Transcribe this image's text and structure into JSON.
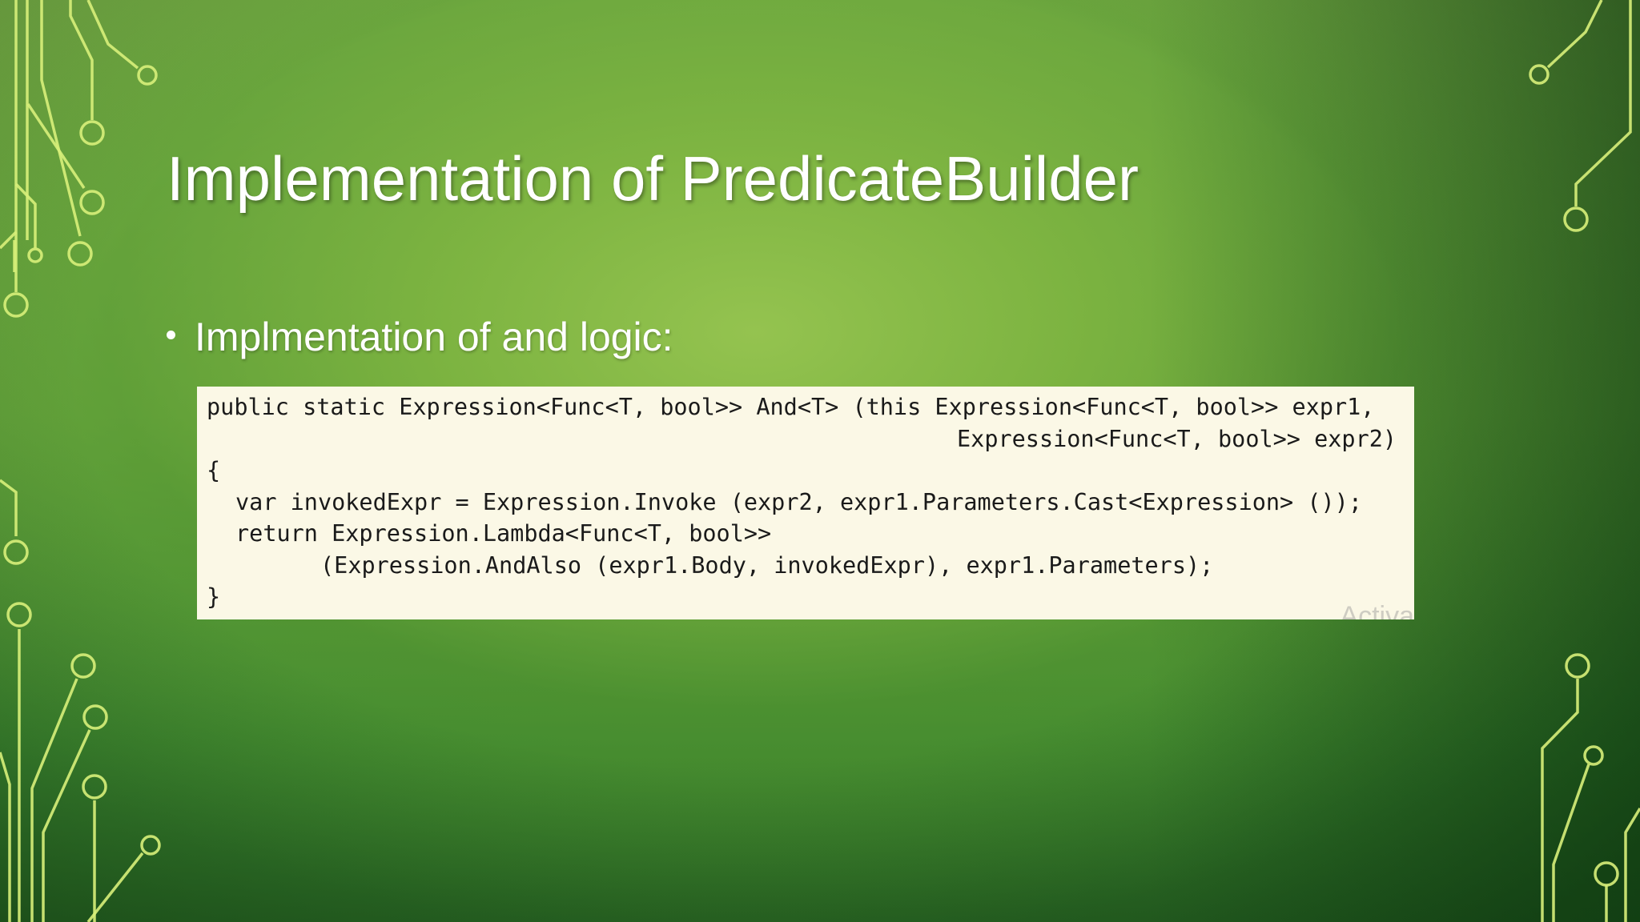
{
  "slide": {
    "title": "Implementation of PredicateBuilder",
    "bullet": "Implmentation of and logic:",
    "code": {
      "line1": "public static Expression<Func<T, bool>> And<T> (this Expression<Func<T, bool>> expr1,",
      "line2": "Expression<Func<T, bool>> expr2)",
      "line3": "{",
      "line4": "var invokedExpr = Expression.Invoke (expr2, expr1.Parameters.Cast<Expression> ());",
      "line5": "return Expression.Lambda<Func<T, bool>>",
      "line6": "(Expression.AndAlso (expr1.Body, invokedExpr), expr1.Parameters);",
      "line7": "}"
    },
    "watermark": "Activa"
  },
  "colors": {
    "background_center": "#8cc152",
    "background_edge": "#2b6a25",
    "circuit_lines": "#d8ef7a",
    "title_text": "#ffffff",
    "code_background": "#fbf8e6",
    "code_text": "#1a1a1a"
  },
  "icons": {
    "decoration": "circuit-board-traces"
  }
}
